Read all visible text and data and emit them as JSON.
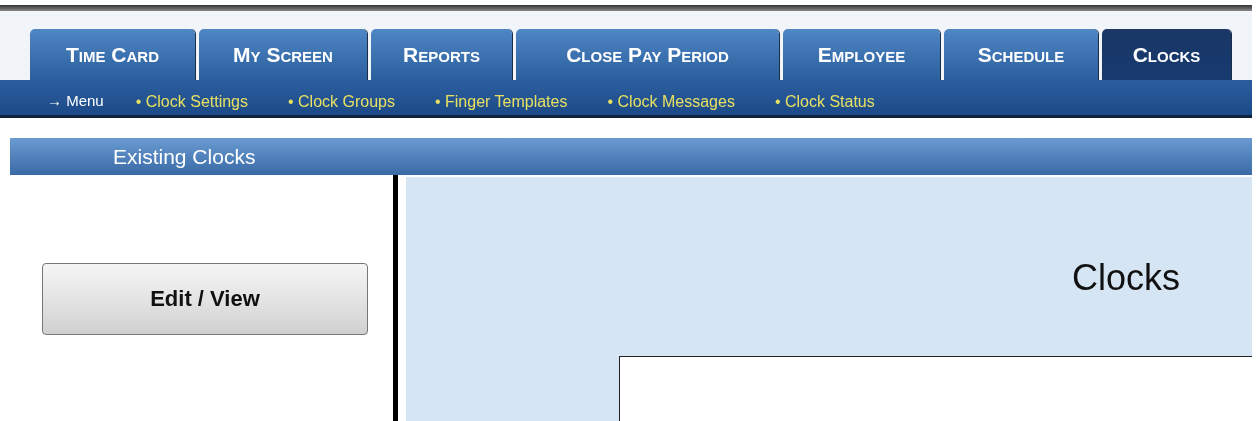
{
  "tabs": [
    {
      "label": "Time Card",
      "selected": false
    },
    {
      "label": "My Screen",
      "selected": false
    },
    {
      "label": "Reports",
      "selected": false
    },
    {
      "label": "Close Pay Period",
      "selected": false
    },
    {
      "label": "Employee",
      "selected": false
    },
    {
      "label": "Schedule",
      "selected": false
    },
    {
      "label": "Clocks",
      "selected": true
    }
  ],
  "subnav": {
    "menu_link": "→ Menu",
    "items": [
      "• Clock Settings",
      "• Clock Groups",
      "• Finger Templates",
      "• Clock Messages",
      "• Clock Status"
    ]
  },
  "section_header": "Existing Clocks",
  "sidebar": {
    "buttons": [
      "Edit / View"
    ]
  },
  "main": {
    "title": "Clocks"
  }
}
